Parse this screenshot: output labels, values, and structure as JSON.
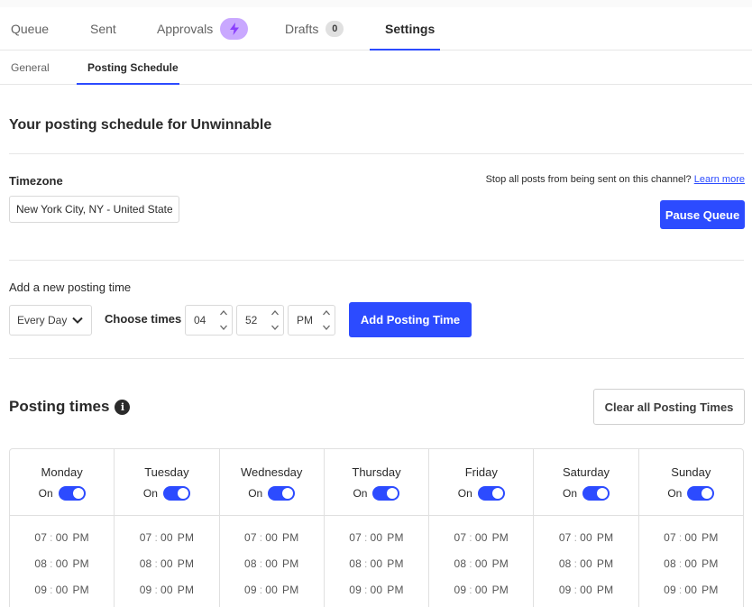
{
  "top_tabs": {
    "queue": "Queue",
    "sent": "Sent",
    "approvals": "Approvals",
    "drafts": "Drafts",
    "drafts_count": "0",
    "settings": "Settings"
  },
  "sub_tabs": {
    "general": "General",
    "posting_schedule": "Posting Schedule"
  },
  "heading": "Your posting schedule for Unwinnable",
  "timezone": {
    "label": "Timezone",
    "value": "New York City, NY - United States"
  },
  "pause": {
    "text": "Stop all posts from being sent on this channel?",
    "link": "Learn more",
    "button": "Pause Queue"
  },
  "add_time": {
    "label": "Add a new posting time",
    "day_select": "Every Day",
    "choose_label": "Choose times",
    "hour": "04",
    "minute": "52",
    "ampm": "PM",
    "button": "Add Posting Time"
  },
  "posting_times": {
    "title": "Posting times",
    "info_glyph": "i",
    "clear_button": "Clear all Posting Times",
    "toggle_label": "On",
    "days": [
      "Monday",
      "Tuesday",
      "Wednesday",
      "Thursday",
      "Friday",
      "Saturday",
      "Sunday"
    ],
    "times": [
      {
        "h": "07",
        "m": "00",
        "p": "PM"
      },
      {
        "h": "08",
        "m": "00",
        "p": "PM"
      },
      {
        "h": "09",
        "m": "00",
        "p": "PM"
      }
    ]
  },
  "colors": {
    "accent": "#2c4bff",
    "approvals_pill": "#c9a8ff"
  },
  "icons": {
    "approvals": "lightning-icon",
    "info": "info-icon",
    "select": "chevron-down-icon",
    "stepper_up": "chevron-up-icon",
    "stepper_down": "chevron-down-icon"
  }
}
